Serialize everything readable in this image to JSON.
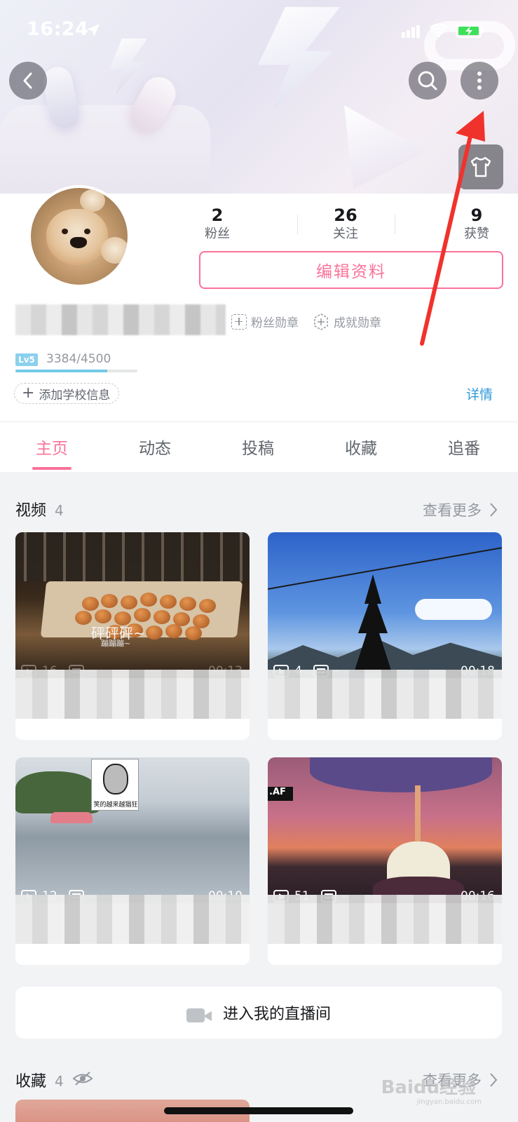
{
  "status_bar": {
    "time": "16:24"
  },
  "profile": {
    "stats": [
      {
        "value": "2",
        "label": "粉丝"
      },
      {
        "value": "26",
        "label": "关注"
      },
      {
        "value": "9",
        "label": "获赞"
      }
    ],
    "edit_label": "编辑资料",
    "fans_badge": "粉丝勋章",
    "achievement_badge": "成就勋章",
    "level": "Lv5",
    "exp": "3384/4500",
    "exp_fraction": 0.752,
    "school_label": "添加学校信息",
    "details_label": "详情"
  },
  "tabs": [
    "主页",
    "动态",
    "投稿",
    "收藏",
    "追番"
  ],
  "videos_section": {
    "title": "视频",
    "count": "4",
    "more_label": "查看更多",
    "items": [
      {
        "plays": "16",
        "danmaku": "-",
        "duration": "00:13",
        "overlay_text": "砰砰砰~",
        "overlay_sub": "蹦蹦蹦~"
      },
      {
        "plays": "4",
        "danmaku": "-",
        "duration": "00:18"
      },
      {
        "plays": "12",
        "danmaku": "-",
        "duration": "00:10",
        "meme_caption": "笑的越来越猖狂"
      },
      {
        "plays": "51",
        "danmaku": "-",
        "duration": "00:16",
        "corner_tag": ".AF"
      }
    ]
  },
  "live_button_label": "进入我的直播间",
  "favorites_section": {
    "title": "收藏",
    "count": "4",
    "more_label": "查看更多"
  },
  "watermark": {
    "main": "Baidu经验",
    "sub": "jingyan.baidu.com"
  },
  "colors": {
    "accent": "#fb7299",
    "link": "#2e9ad9",
    "arrow": "#f0322d"
  }
}
